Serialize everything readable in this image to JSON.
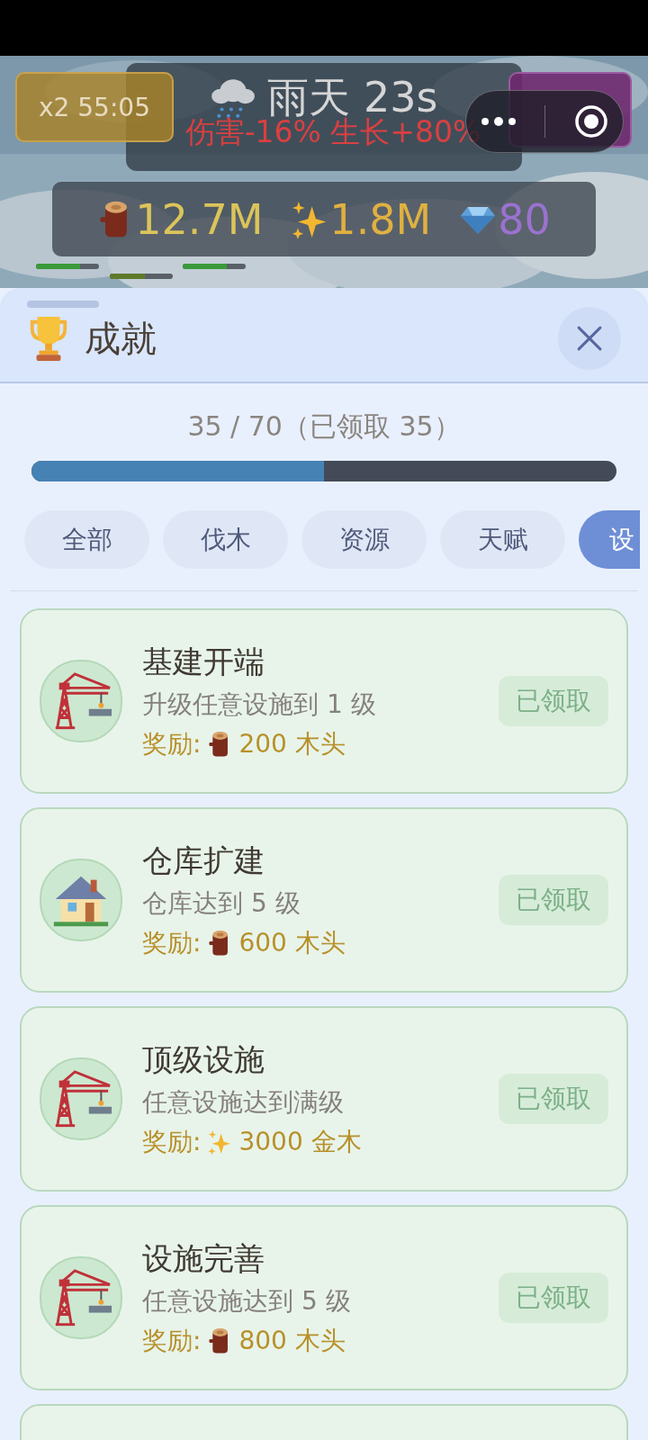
{
  "hud": {
    "boost": "x2 55:05",
    "weather": {
      "kind": "rain",
      "title": "雨天 23s",
      "effect": "伤害-16% 生长+80%"
    },
    "resources": [
      {
        "kind": "wood",
        "value": "12.7M"
      },
      {
        "kind": "gold",
        "value": "1.8M"
      },
      {
        "kind": "gem",
        "value": "80"
      }
    ],
    "mini_bars": [
      {
        "level": 0.7
      },
      {
        "level": 0.55
      },
      {
        "level": 0.7
      }
    ]
  },
  "panel": {
    "title": "成就",
    "progress": {
      "text": "35 / 70（已领取 35）",
      "level": 0.5
    },
    "tabs": [
      {
        "label": "全部",
        "selected": false
      },
      {
        "label": "伐木",
        "selected": false
      },
      {
        "label": "资源",
        "selected": false
      },
      {
        "label": "天赋",
        "selected": false
      },
      {
        "label": "设",
        "selected": true
      }
    ],
    "achievements": [
      {
        "kind": "crane",
        "title": "基建开端",
        "description": "升级任意设施到 1 级",
        "reward_label": "奖励:",
        "reward": {
          "kind": "wood",
          "text": "200 木头"
        },
        "status": "已领取",
        "claimed": true
      },
      {
        "kind": "house",
        "title": "仓库扩建",
        "description": "仓库达到 5 级",
        "reward_label": "奖励:",
        "reward": {
          "kind": "wood",
          "text": "600 木头"
        },
        "status": "已领取",
        "claimed": true
      },
      {
        "kind": "crane",
        "title": "顶级设施",
        "description": "任意设施达到满级",
        "reward_label": "奖励:",
        "reward": {
          "kind": "gold",
          "text": "3000 金木"
        },
        "status": "已领取",
        "claimed": true
      },
      {
        "kind": "crane",
        "title": "设施完善",
        "description": "任意设施达到 5 级",
        "reward_label": "奖励:",
        "reward": {
          "kind": "wood",
          "text": "800 木头"
        },
        "status": "已领取",
        "claimed": true
      }
    ]
  }
}
